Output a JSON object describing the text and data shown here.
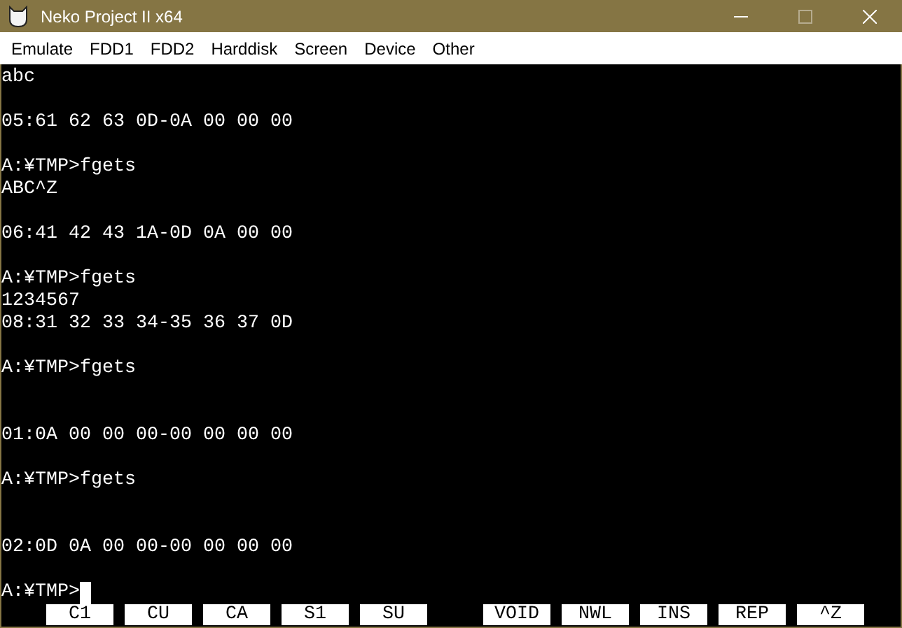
{
  "window": {
    "title": "Neko Project II x64"
  },
  "menu": [
    "Emulate",
    "FDD1",
    "FDD2",
    "Harddisk",
    "Screen",
    "Device",
    "Other"
  ],
  "screen": {
    "lines": [
      {
        "kind": "text",
        "text": "abc"
      },
      {
        "kind": "blank"
      },
      {
        "kind": "text",
        "text": "05:61 62 63 0D-0A 00 00 00"
      },
      {
        "kind": "blank"
      },
      {
        "kind": "text",
        "text": "A:¥TMP>fgets"
      },
      {
        "kind": "text",
        "text": "ABC^Z"
      },
      {
        "kind": "blank"
      },
      {
        "kind": "text",
        "text": "06:41 42 43 1A-0D 0A 00 00"
      },
      {
        "kind": "blank"
      },
      {
        "kind": "text",
        "text": "A:¥TMP>fgets"
      },
      {
        "kind": "text",
        "text": "1234567"
      },
      {
        "kind": "text",
        "text": "08:31 32 33 34-35 36 37 0D"
      },
      {
        "kind": "blank"
      },
      {
        "kind": "text",
        "text": "A:¥TMP>fgets"
      },
      {
        "kind": "blank"
      },
      {
        "kind": "blank"
      },
      {
        "kind": "text",
        "text": "01:0A 00 00 00-00 00 00 00"
      },
      {
        "kind": "blank"
      },
      {
        "kind": "text",
        "text": "A:¥TMP>fgets"
      },
      {
        "kind": "blank"
      },
      {
        "kind": "blank"
      },
      {
        "kind": "text",
        "text": "02:0D 0A 00 00-00 00 00 00"
      },
      {
        "kind": "blank"
      },
      {
        "kind": "prompt",
        "text": "A:¥TMP>",
        "cursor": true
      }
    ],
    "function_keys": [
      {
        "kind": "key",
        "label": "C1"
      },
      {
        "kind": "key",
        "label": "CU"
      },
      {
        "kind": "key",
        "label": "CA"
      },
      {
        "kind": "key",
        "label": "S1"
      },
      {
        "kind": "key",
        "label": "SU"
      },
      {
        "kind": "spacer"
      },
      {
        "kind": "key",
        "label": "VOID"
      },
      {
        "kind": "key",
        "label": "NWL"
      },
      {
        "kind": "key",
        "label": "INS"
      },
      {
        "kind": "key",
        "label": "REP"
      },
      {
        "kind": "key",
        "label": "^Z"
      }
    ]
  }
}
